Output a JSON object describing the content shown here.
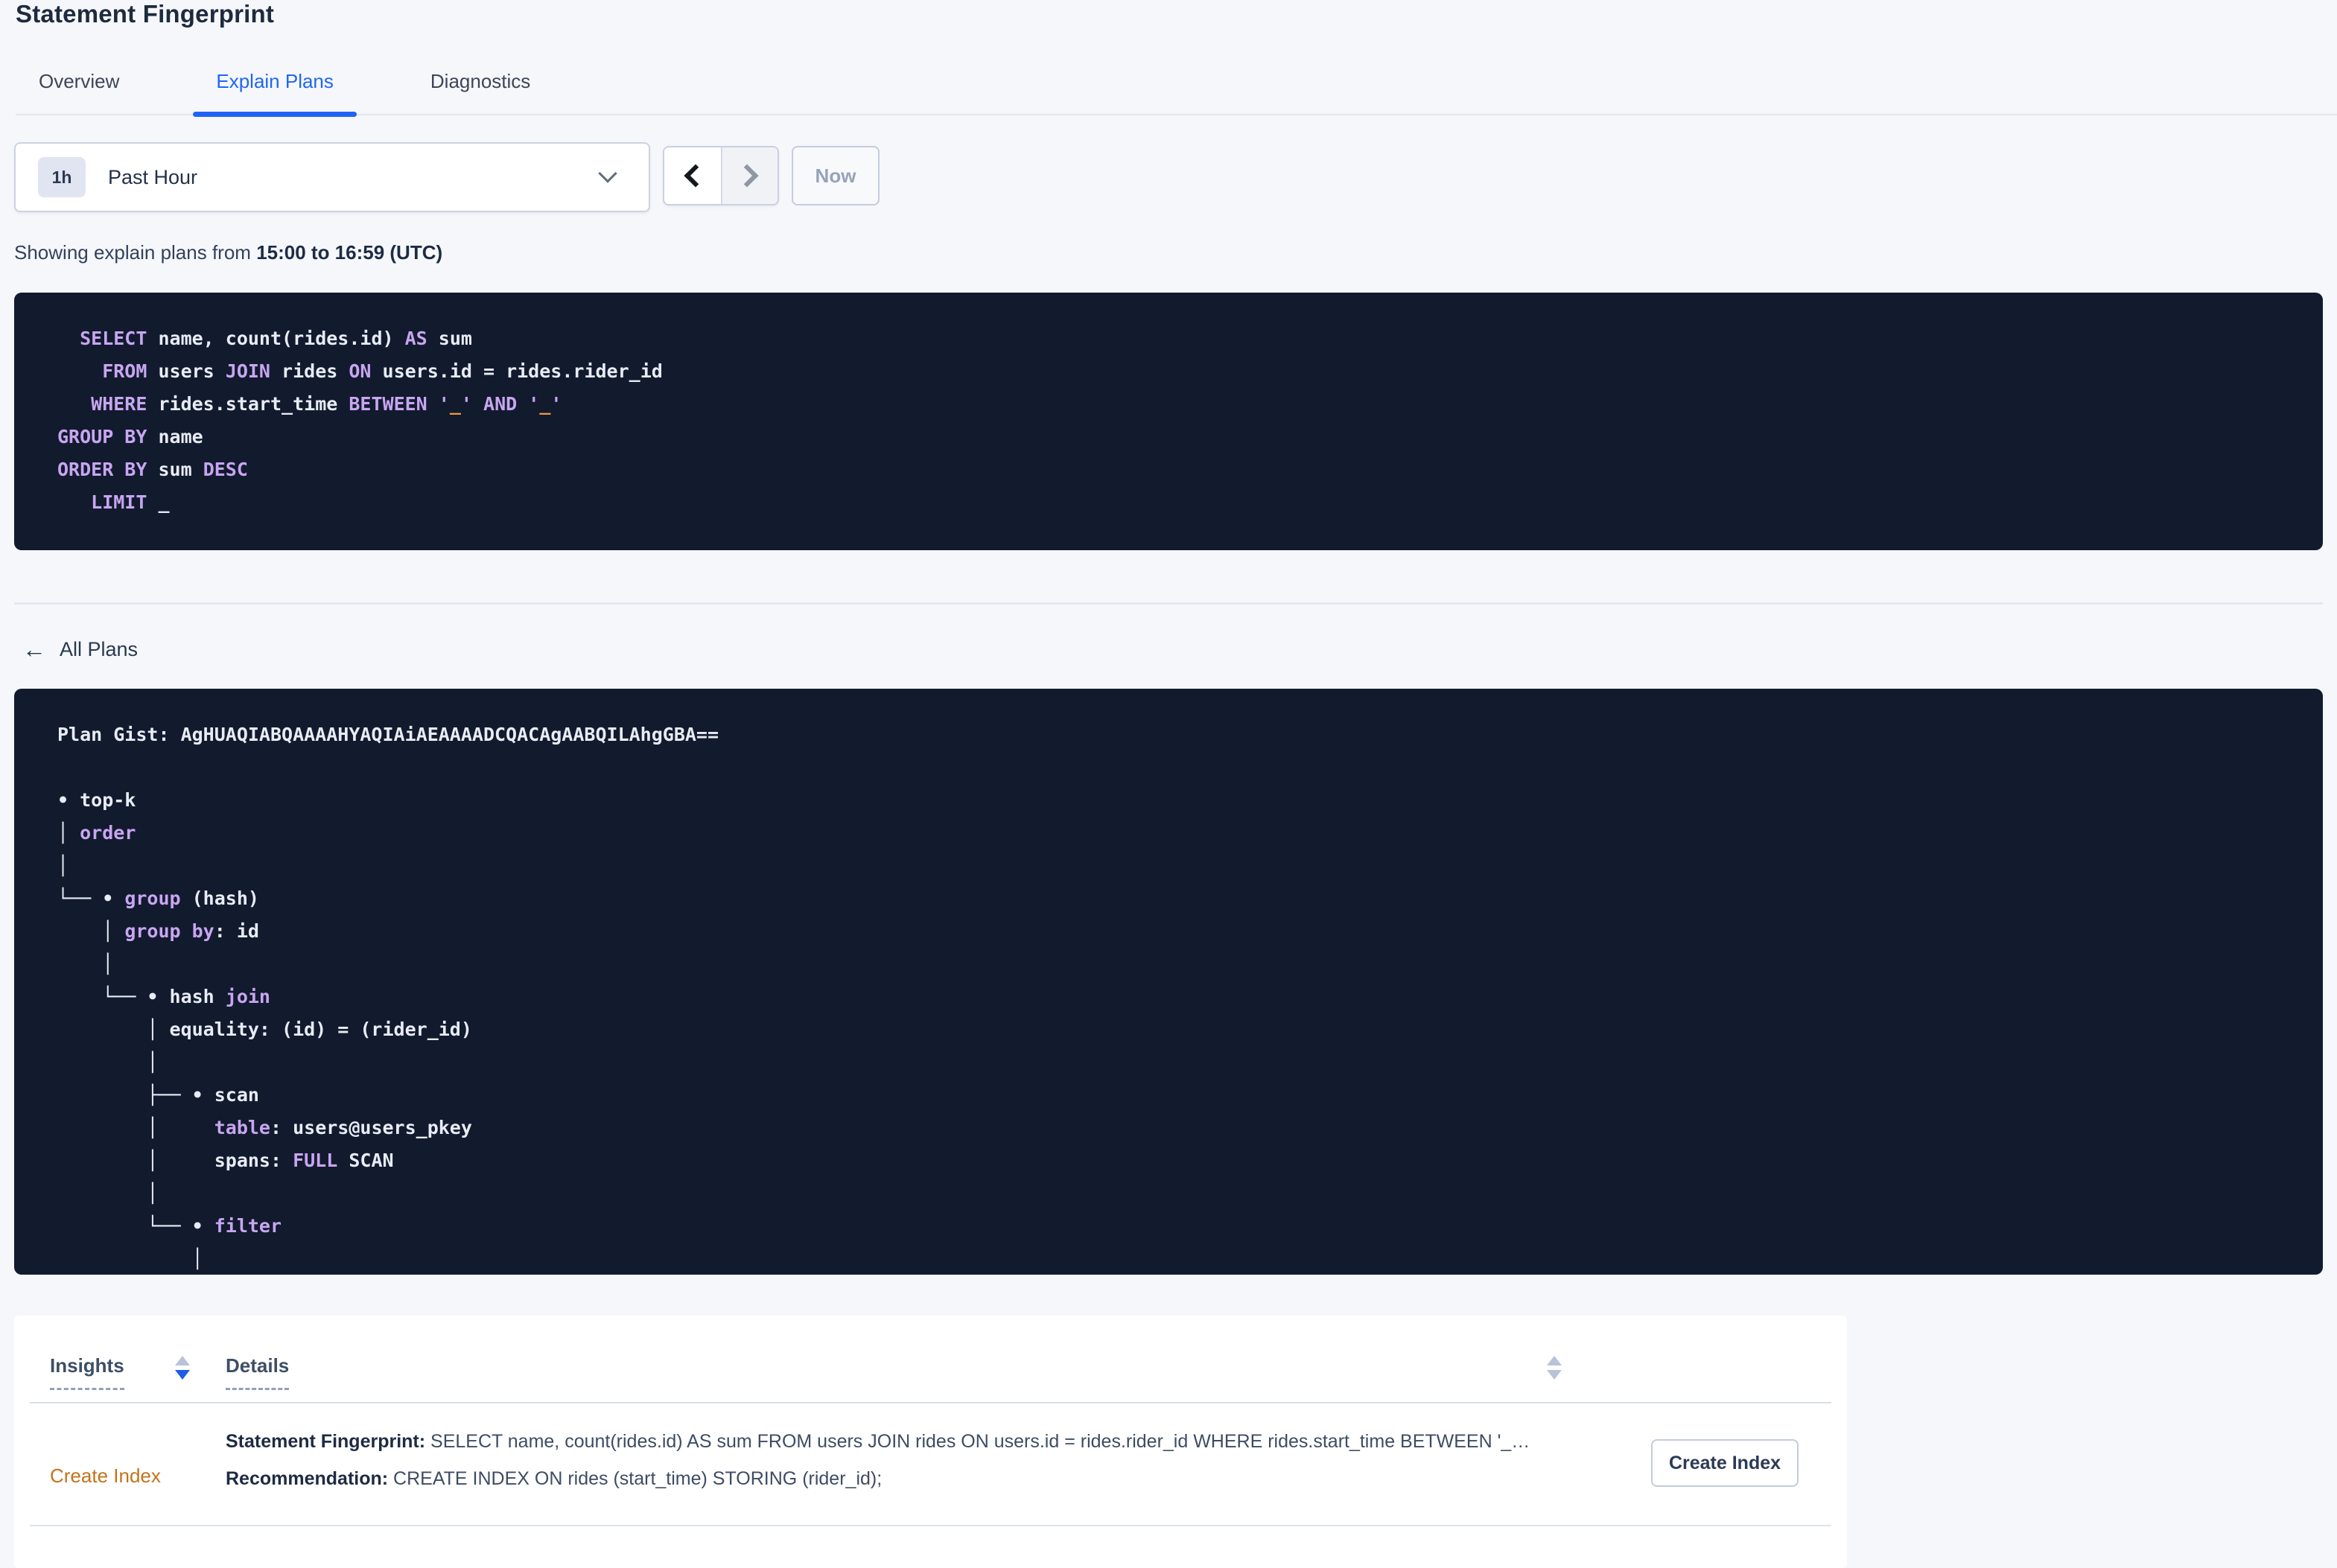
{
  "header": {
    "title": "Statement Fingerprint"
  },
  "tabs": [
    {
      "label": "Overview"
    },
    {
      "label": "Explain Plans"
    },
    {
      "label": "Diagnostics"
    }
  ],
  "active_tab": "Explain Plans",
  "time_selector": {
    "interval_badge": "1h",
    "selected_range": "Past Hour",
    "now_label": "Now"
  },
  "subtitle": {
    "prefix": "Showing explain plans from ",
    "range": "15:00 to 16:59 (UTC)"
  },
  "sql": {
    "lines": [
      [
        [
          "k",
          "  SELECT"
        ],
        [
          "w",
          " name, count(rides.id) "
        ],
        [
          "k",
          "AS"
        ],
        [
          "w",
          " sum"
        ]
      ],
      [
        [
          "k",
          "    FROM"
        ],
        [
          "w",
          " users "
        ],
        [
          "k",
          "JOIN"
        ],
        [
          "w",
          " rides "
        ],
        [
          "k",
          "ON"
        ],
        [
          "w",
          " users.id = rides.rider_id"
        ]
      ],
      [
        [
          "k",
          "   WHERE"
        ],
        [
          "w",
          " rides.start_time "
        ],
        [
          "k",
          "BETWEEN"
        ],
        [
          "w",
          " "
        ],
        [
          "k",
          "'"
        ],
        [
          "o",
          "_"
        ],
        [
          "k",
          "'"
        ],
        [
          "w",
          " "
        ],
        [
          "k",
          "AND"
        ],
        [
          "w",
          " "
        ],
        [
          "k",
          "'"
        ],
        [
          "o",
          "_"
        ],
        [
          "k",
          "'"
        ]
      ],
      [
        [
          "k",
          "GROUP BY"
        ],
        [
          "w",
          " name"
        ]
      ],
      [
        [
          "k",
          "ORDER BY"
        ],
        [
          "w",
          " sum "
        ],
        [
          "k",
          "DESC"
        ]
      ],
      [
        [
          "k",
          "   LIMIT"
        ],
        [
          "w",
          " _"
        ]
      ]
    ]
  },
  "all_plans": {
    "icon": "←",
    "label": "All Plans"
  },
  "plan": {
    "lines": [
      [
        [
          "w",
          "Plan Gist: AgHUAQIABQAAAAHYAQIAiAEAAAADCQACAgAABQILAhgGBA=="
        ]
      ],
      [
        [
          "w",
          " "
        ]
      ],
      [
        [
          "w",
          "• top-k"
        ]
      ],
      [
        [
          "w",
          "│ "
        ],
        [
          "k",
          "order"
        ]
      ],
      [
        [
          "w",
          "│"
        ]
      ],
      [
        [
          "w",
          "└── • "
        ],
        [
          "k",
          "group"
        ],
        [
          "w",
          " (hash)"
        ]
      ],
      [
        [
          "w",
          "    │ "
        ],
        [
          "k",
          "group by"
        ],
        [
          "w",
          ": id"
        ]
      ],
      [
        [
          "w",
          "    │"
        ]
      ],
      [
        [
          "w",
          "    └── • hash "
        ],
        [
          "k",
          "join"
        ]
      ],
      [
        [
          "w",
          "        │ equality: (id) = (rider_id)"
        ]
      ],
      [
        [
          "w",
          "        │"
        ]
      ],
      [
        [
          "w",
          "        ├── • scan"
        ]
      ],
      [
        [
          "w",
          "        │     "
        ],
        [
          "k",
          "table"
        ],
        [
          "w",
          ": users@users_pkey"
        ]
      ],
      [
        [
          "w",
          "        │     spans: "
        ],
        [
          "k",
          "FULL"
        ],
        [
          "w",
          " SCAN"
        ]
      ],
      [
        [
          "w",
          "        │"
        ]
      ],
      [
        [
          "w",
          "        └── • "
        ],
        [
          "k",
          "filter"
        ]
      ],
      [
        [
          "w",
          "            │"
        ]
      ]
    ]
  },
  "insights_table": {
    "columns": [
      {
        "label": "Insights",
        "sort": "desc"
      },
      {
        "label": "Details",
        "sort": "none"
      }
    ],
    "row": {
      "insight": "Create Index",
      "detail_lines": [
        {
          "label": "Statement Fingerprint:",
          "text": " SELECT name, count(rides.id) AS sum FROM users JOIN rides ON users.id = rides.rider_id WHERE rides.start_time BETWEEN '_…"
        },
        {
          "label": "Recommendation:",
          "text": " CREATE INDEX ON rides (start_time) STORING (rider_id);"
        }
      ],
      "action_label": "Create Index"
    }
  },
  "colors": {
    "accent_blue": "#2064F5",
    "code_background": "#121A2E",
    "code_keyword": "#C7A6F0",
    "code_text": "#E8ECF4",
    "code_literal": "#EA9A3C",
    "insight_link_orange": "#C4731A",
    "page_background": "#F5F7FA"
  }
}
